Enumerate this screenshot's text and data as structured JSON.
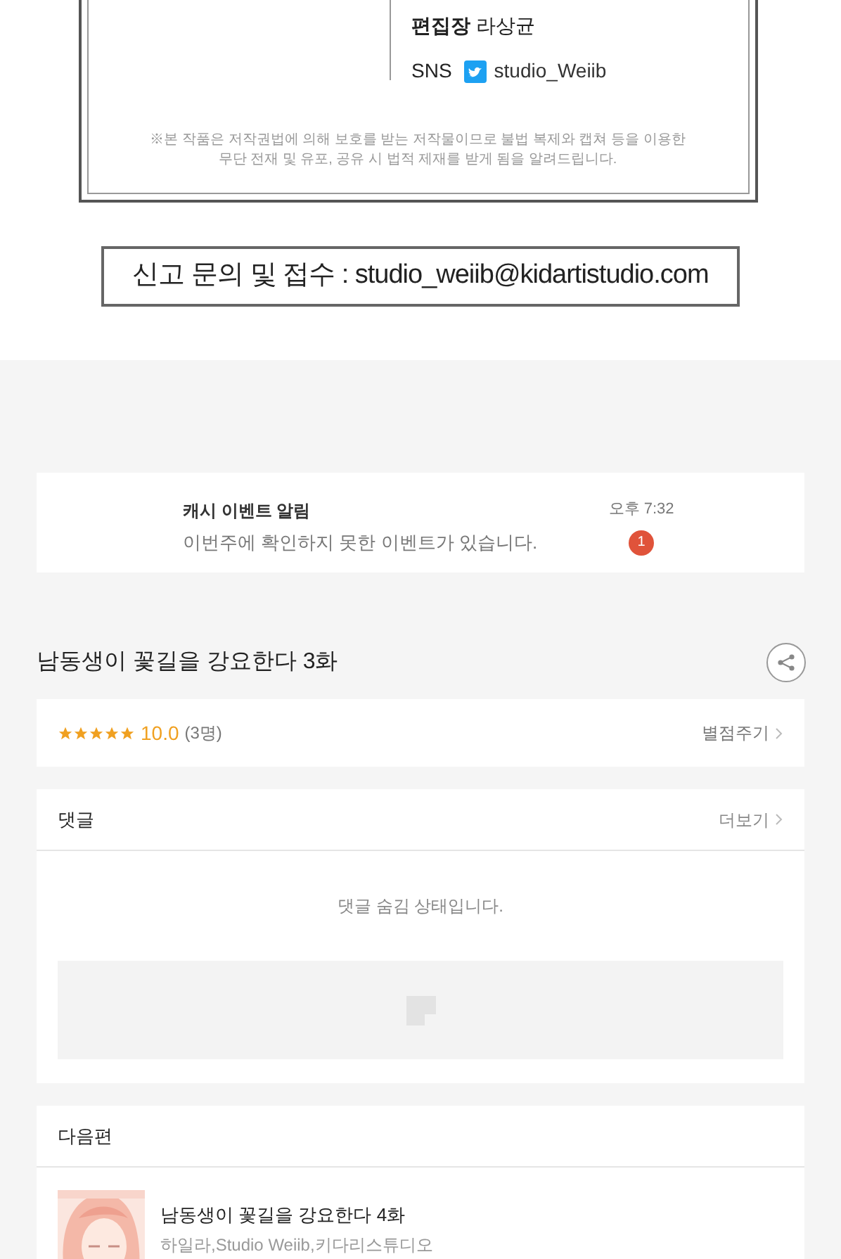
{
  "credits": {
    "editor_label": "편집장",
    "editor_name": "라상균",
    "sns_label": "SNS",
    "sns_handle": "studio_Weiib",
    "notice": [
      "※본 작품은 저작권법에 의해 보호를 받는 저작물이므로 불법 복제와 캡쳐 등을 이용한",
      "무단 전재 및 유포, 공유 시 법적 제재를 받게 됨을 알려드립니다."
    ],
    "report": "신고 문의 및 접수 : studio_weiib@kidartistudio.com"
  },
  "notification": {
    "title": "캐시 이벤트 알림",
    "message": "이번주에 확인하지 못한 이벤트가 있습니다.",
    "time": "오후 7:32",
    "badge": "1"
  },
  "episode": {
    "title": "남동생이 꽃길을 강요한다 3화"
  },
  "rating": {
    "stars": 5,
    "score": "10.0",
    "count": "(3명)",
    "action": "별점주기"
  },
  "comments": {
    "title": "댓글",
    "more": "더보기",
    "hidden_message": "댓글 숨김 상태입니다."
  },
  "next": {
    "title": "다음편",
    "items": [
      {
        "kind": "picture",
        "title": "남동생이 꽃길을 강요한다 4화",
        "authors": "하일라,Studio Weiib,키다리스튜디오"
      }
    ]
  }
}
